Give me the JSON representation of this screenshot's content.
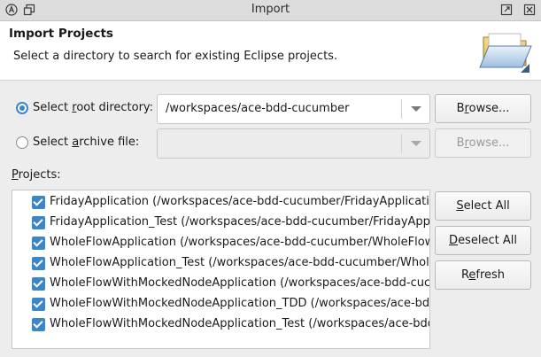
{
  "window": {
    "title": "Import"
  },
  "header": {
    "title": "Import Projects",
    "description": "Select a directory to search for existing Eclipse projects."
  },
  "root_dir": {
    "label_pre": "Select ",
    "label_ul": "r",
    "label_post": "oot directory:",
    "value": "/workspaces/ace-bdd-cucumber",
    "selected": true
  },
  "archive": {
    "label_pre": "Select ",
    "label_ul": "a",
    "label_post": "rchive file:",
    "value": "",
    "selected": false
  },
  "buttons": {
    "browse1_pre": "B",
    "browse1_ul": "r",
    "browse1_post": "owse...",
    "browse2_pre": "B",
    "browse2_ul": "r",
    "browse2_post": "owse...",
    "select_all_ul": "S",
    "select_all_post": "elect All",
    "deselect_all_ul": "D",
    "deselect_all_post": "eselect All",
    "refresh_pre": "R",
    "refresh_ul": "e",
    "refresh_post": "fresh"
  },
  "projects": {
    "label_pre": "",
    "label_ul": "P",
    "label_post": "rojects:",
    "items": [
      {
        "text": "FridayApplication (/workspaces/ace-bdd-cucumber/FridayApplication)",
        "checked": true
      },
      {
        "text": "FridayApplication_Test (/workspaces/ace-bdd-cucumber/FridayApplication_Test)",
        "checked": true
      },
      {
        "text": "WholeFlowApplication (/workspaces/ace-bdd-cucumber/WholeFlowApplication)",
        "checked": true
      },
      {
        "text": "WholeFlowApplication_Test (/workspaces/ace-bdd-cucumber/WholeFlowApplication_Test)",
        "checked": true
      },
      {
        "text": "WholeFlowWithMockedNodeApplication (/workspaces/ace-bdd-cucumber/WholeFlowWithMockedNodeApplication)",
        "checked": true
      },
      {
        "text": "WholeFlowWithMockedNodeApplication_TDD (/workspaces/ace-bdd-cucumber/WholeFlowWithMockedNodeApplication_TDD)",
        "checked": true
      },
      {
        "text": "WholeFlowWithMockedNodeApplication_Test (/workspaces/ace-bdd-cucumber/WholeFlowWithMockedNodeApplication_Test)",
        "checked": true
      }
    ]
  },
  "colors": {
    "accent": "#3b86c9"
  }
}
